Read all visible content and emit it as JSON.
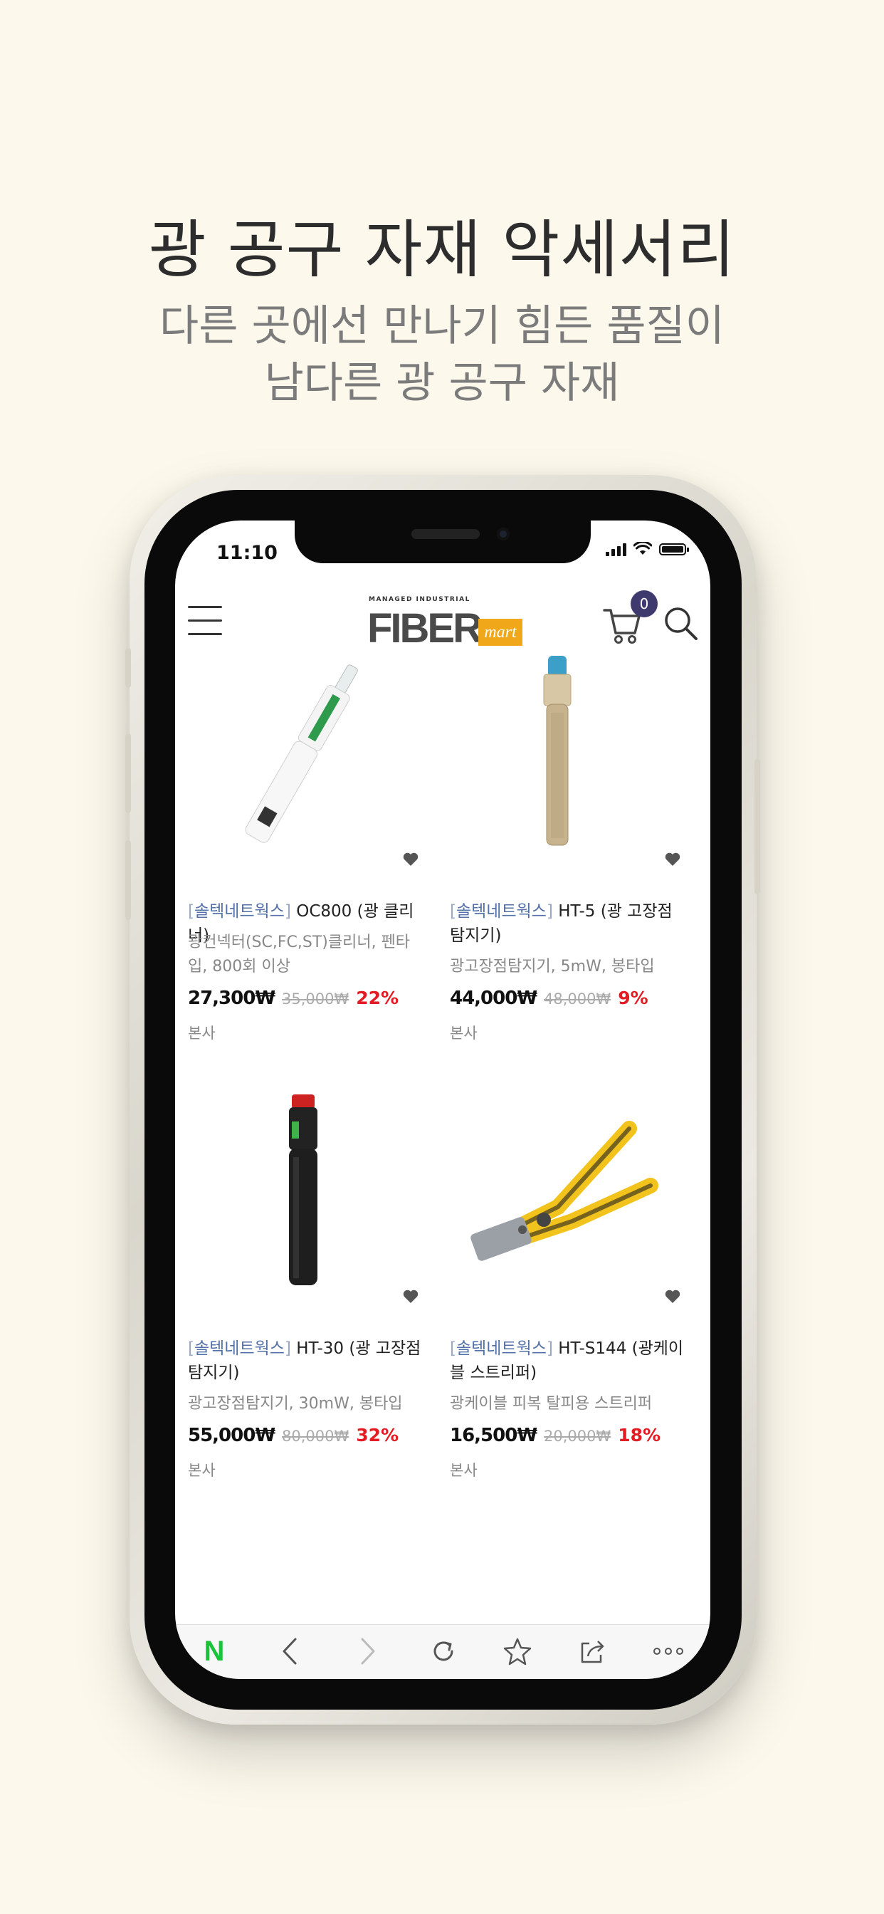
{
  "promo": {
    "title": "광 공구 자재 악세서리",
    "subtitle_line1": "다른 곳에선 만나기 힘든 품질이",
    "subtitle_line2": "남다른 광 공구 자재"
  },
  "status_bar": {
    "time": "11:10"
  },
  "header": {
    "logo_small": "MANAGED INDUSTRIAL",
    "logo_main": "FIBER",
    "logo_tag": "mart",
    "cart_count": "0"
  },
  "products": [
    {
      "brand_open": "[",
      "brand": "솔텍네트웍스",
      "brand_close": "]",
      "name": " OC800 (광 클리너)",
      "desc": "광컨넥터(SC,FC,ST)클리너, 펜타입, 800회 이상",
      "price": "27,300₩",
      "original": "35,000₩",
      "discount": "22%",
      "store": "본사"
    },
    {
      "brand_open": "[",
      "brand": "솔텍네트웍스",
      "brand_close": "]",
      "name": " HT-5 (광 고장점탐지기)",
      "desc": "광고장점탐지기, 5mW, 봉타입",
      "price": "44,000₩",
      "original": "48,000₩",
      "discount": "9%",
      "store": "본사"
    },
    {
      "brand_open": "[",
      "brand": "솔텍네트웍스",
      "brand_close": "]",
      "name": " HT-30 (광 고장점탐지기)",
      "desc": "광고장점탐지기, 30mW, 봉타입",
      "price": "55,000₩",
      "original": "80,000₩",
      "discount": "32%",
      "store": "본사"
    },
    {
      "brand_open": "[",
      "brand": "솔텍네트웍스",
      "brand_close": "]",
      "name": " HT-S144 (광케이블 스트리퍼)",
      "desc": "광케이블 피복 탈피용 스트리퍼",
      "price": "16,500₩",
      "original": "20,000₩",
      "discount": "18%",
      "store": "본사"
    }
  ],
  "bottom_bar": {
    "home_label": "N",
    "icons": [
      "naver-home-icon",
      "back-icon",
      "forward-icon",
      "refresh-icon",
      "bookmark-star-icon",
      "share-icon",
      "more-icon"
    ]
  },
  "colors": {
    "background": "#fcf8ec",
    "brand_link": "#5470a8",
    "discount": "#e31b23",
    "cart_badge": "#3e3a6e",
    "logo_accent": "#f0a81a",
    "naver_green": "#19c33a"
  }
}
